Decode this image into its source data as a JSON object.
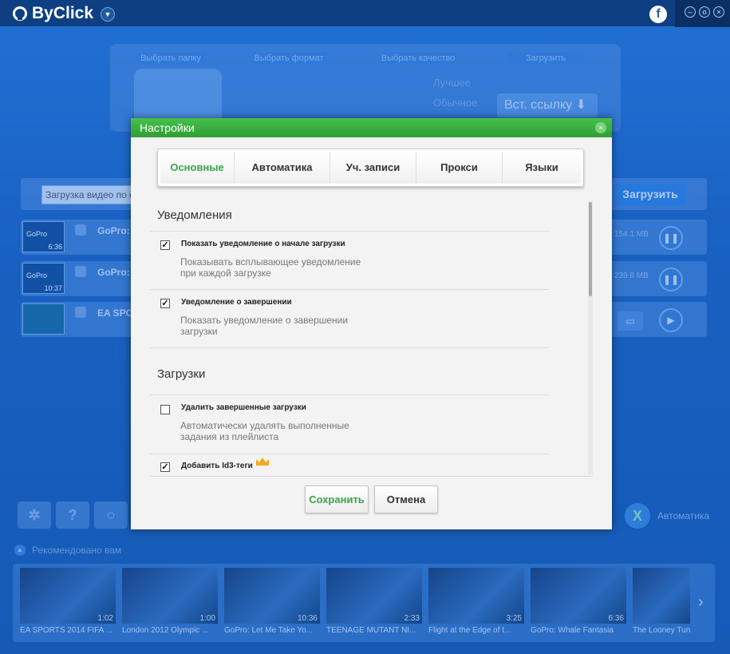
{
  "app": {
    "title": "ByClick"
  },
  "steps": {
    "folder": "Выбрать папку",
    "format": "Выбрать формат",
    "quality": "Выбрать качество",
    "download": "Загрузить",
    "quality_best": "Лучшее",
    "quality_normal": "Обычное",
    "paste_label": "Вст. ссылку"
  },
  "urlbar": {
    "value": "Загрузка видео по с",
    "download_label": "Загрузить"
  },
  "rows": [
    {
      "title": "GoPro:",
      "size": "154.1 MB",
      "duration": "6:36",
      "thumb": "GoPro"
    },
    {
      "title": "GoPro:",
      "size": "239.8 MB",
      "duration": "10:37",
      "thumb": "GoPro"
    },
    {
      "title": "EA SPO",
      "size": "",
      "duration": "",
      "thumb": ""
    }
  ],
  "bottom": {
    "auto_label": "Автоматика",
    "recommended": "Рекомендовано вам"
  },
  "videos": [
    {
      "title": "EA SPORTS 2014 FIFA ...",
      "duration": "1:02"
    },
    {
      "title": "London 2012 Olympic ...",
      "duration": "1:00"
    },
    {
      "title": "GoPro: Let Me Take Yo...",
      "duration": "10:36"
    },
    {
      "title": "TEENAGE MUTANT NI...",
      "duration": "2:33"
    },
    {
      "title": "Flight at the Edge of t...",
      "duration": "3:25"
    },
    {
      "title": "GoPro: Whale Fantasia",
      "duration": "6:36"
    },
    {
      "title": "The Looney Tun",
      "duration": ""
    }
  ],
  "dialog": {
    "title": "Настройки",
    "tabs": [
      "Основные",
      "Автоматика",
      "Уч. записи",
      "Прокси",
      "Языки"
    ],
    "notifications": {
      "heading": "Уведомления",
      "opt1": {
        "label": "Показать уведомление о начале загрузки",
        "desc": "Показывать всплывающее уведомление при каждой загрузке",
        "checked": true
      },
      "opt2": {
        "label": "Уведомление о завершении",
        "desc": "Показать уведомление о завершении загрузки",
        "checked": true
      }
    },
    "downloads": {
      "heading": "Загрузки",
      "opt1": {
        "label": "Удалить завершенные загрузки",
        "desc": "Автоматически удалять выполненные задания из плейлиста",
        "checked": false
      },
      "opt2": {
        "label": "Добавить Id3-теги",
        "checked": true
      }
    },
    "save_label": "Сохранить",
    "cancel_label": "Отмена"
  },
  "colors": {
    "accent": "#3aa44a",
    "title_green": "#3aa640",
    "app_blue": "#1c62b8"
  }
}
